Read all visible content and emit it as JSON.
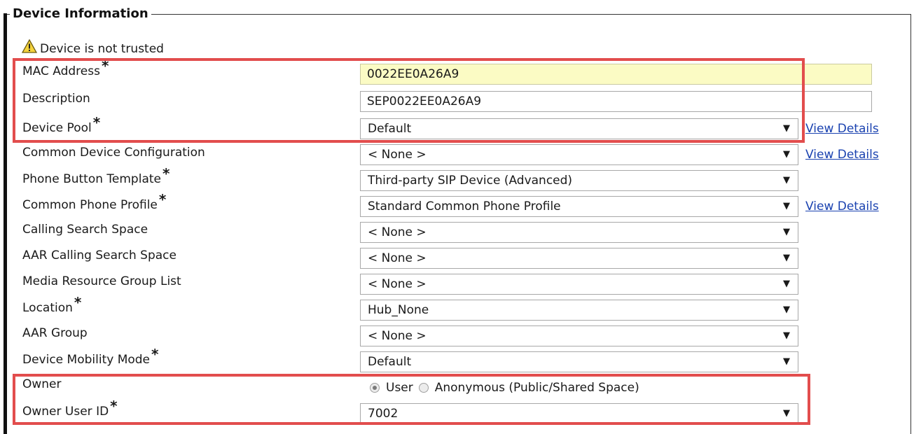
{
  "section": {
    "title": "Device Information"
  },
  "warning": {
    "icon": "warning-triangle-icon",
    "text": "Device is not trusted"
  },
  "required_mark": "*",
  "fields": {
    "mac_address": {
      "label": "MAC Address",
      "value": "0022EE0A26A9",
      "required": true
    },
    "description": {
      "label": "Description",
      "value": "SEP0022EE0A26A9",
      "required": false
    },
    "device_pool": {
      "label": "Device Pool",
      "value": "Default",
      "required": true,
      "link": "View Details"
    },
    "common_device_configuration": {
      "label": "Common Device Configuration",
      "value": "< None >",
      "required": false,
      "link": "View Details"
    },
    "phone_button_template": {
      "label": "Phone Button Template",
      "value": "Third-party SIP Device (Advanced)",
      "required": true
    },
    "common_phone_profile": {
      "label": "Common Phone Profile",
      "value": "Standard Common Phone Profile",
      "required": true,
      "link": "View Details"
    },
    "calling_search_space": {
      "label": "Calling Search Space",
      "value": "< None >",
      "required": false
    },
    "aar_calling_search_space": {
      "label": "AAR Calling Search Space",
      "value": "< None >",
      "required": false
    },
    "media_resource_group_list": {
      "label": "Media Resource Group List",
      "value": "< None >",
      "required": false
    },
    "location": {
      "label": "Location",
      "value": "Hub_None",
      "required": true
    },
    "aar_group": {
      "label": "AAR Group",
      "value": "< None >",
      "required": false
    },
    "device_mobility_mode": {
      "label": "Device Mobility Mode",
      "value": "Default",
      "required": true
    },
    "owner": {
      "label": "Owner",
      "options": [
        "User",
        "Anonymous (Public/Shared Space)"
      ],
      "selected": "User"
    },
    "owner_user_id": {
      "label": "Owner User ID",
      "value": "7002",
      "required": true
    }
  },
  "colors": {
    "highlight_box": "#e24d4d",
    "required_input_bg": "#fbfbc4",
    "link": "#1a42b0"
  }
}
